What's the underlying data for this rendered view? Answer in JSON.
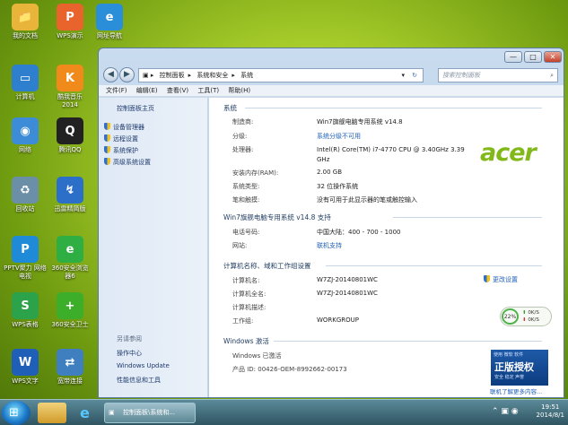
{
  "desktop": {
    "icons": [
      {
        "label": "我的文档",
        "name": "my-documents-icon",
        "color": "#e8b43a",
        "glyph": "📁"
      },
      {
        "label": "WPS演示",
        "name": "wps-presentation-icon",
        "color": "#e8642c",
        "glyph": "P"
      },
      {
        "label": "网址导航",
        "name": "ie-browser-icon",
        "color": "#2a8fd8",
        "glyph": "e"
      },
      {
        "label": "计算机",
        "name": "computer-icon",
        "color": "#2f7fcf",
        "glyph": "▭"
      },
      {
        "label": "酷我音乐\n2014",
        "name": "kuwo-music-icon",
        "color": "#f08a1a",
        "glyph": "K"
      },
      {
        "label": "网络",
        "name": "network-icon",
        "color": "#3c8cd8",
        "glyph": "◉"
      },
      {
        "label": "腾讯QQ",
        "name": "qq-icon",
        "color": "#222222",
        "glyph": "Q"
      },
      {
        "label": "回收站",
        "name": "recycle-bin-icon",
        "color": "#6b8fa6",
        "glyph": "♻"
      },
      {
        "label": "迅雷精简版",
        "name": "xunlei-icon",
        "color": "#2b6fc9",
        "glyph": "↯"
      },
      {
        "label": "PPTV聚力 网络电视",
        "name": "pptv-icon",
        "color": "#1f8ad8",
        "glyph": "P"
      },
      {
        "label": "360安全浏览器6",
        "name": "360-browser-icon",
        "color": "#2fae43",
        "glyph": "e"
      },
      {
        "label": "WPS表格",
        "name": "wps-spreadsheet-icon",
        "color": "#2ca24a",
        "glyph": "S"
      },
      {
        "label": "360安全卫士",
        "name": "360-security-icon",
        "color": "#3cae2a",
        "glyph": "+"
      },
      {
        "label": "WPS文字",
        "name": "wps-writer-icon",
        "color": "#1f5fb8",
        "glyph": "W"
      },
      {
        "label": "宽带连接",
        "name": "broadband-icon",
        "color": "#3f7fbf",
        "glyph": "⇄"
      }
    ]
  },
  "window": {
    "controls": {
      "minimize": "—",
      "maximize": "□",
      "close": "✕"
    },
    "nav": {
      "back": "◀",
      "forward": "▶"
    },
    "breadcrumb": [
      "控制面板",
      "系统和安全",
      "系统"
    ],
    "search_placeholder": "搜索控制面板",
    "menu": [
      "文件(F)",
      "编辑(E)",
      "查看(V)",
      "工具(T)",
      "帮助(H)"
    ]
  },
  "sidebar": {
    "home": "控制面板主页",
    "items": [
      "设备管理器",
      "远程设置",
      "系统保护",
      "高级系统设置"
    ],
    "see_also": "另请参阅",
    "links": [
      "操作中心",
      "Windows Update",
      "性能信息和工具"
    ]
  },
  "system": {
    "section_title": "系统",
    "rows": [
      {
        "label": "制造商:",
        "value": "Win7旗舰电脑专用系统 v14.8"
      },
      {
        "label": "分级:",
        "value": "系统分级不可用"
      },
      {
        "label": "处理器:",
        "value": "Intel(R) Core(TM) i7-4770 CPU @ 3.40GHz   3.39 GHz"
      },
      {
        "label": "安装内存(RAM):",
        "value": "2.00 GB"
      },
      {
        "label": "系统类型:",
        "value": "32 位操作系统"
      },
      {
        "label": "笔和触摸:",
        "value": "没有可用于此显示器的笔或触控输入"
      }
    ],
    "brand_logo": "acer"
  },
  "support": {
    "section_title": "Win7旗舰电脑专用系统 v14.8 支持",
    "rows": [
      {
        "label": "电话号码:",
        "value": "中国大陆：400 - 700 - 1000"
      },
      {
        "label": "网站:",
        "value": "联机支持"
      }
    ]
  },
  "computer": {
    "section_title": "计算机名称、域和工作组设置",
    "rows": [
      {
        "label": "计算机名:",
        "value": "W7ZJ-20140801WC"
      },
      {
        "label": "计算机全名:",
        "value": "W7ZJ-20140801WC"
      },
      {
        "label": "计算机描述:",
        "value": ""
      },
      {
        "label": "工作组:",
        "value": "WORKGROUP"
      }
    ],
    "change_settings": "更改设置"
  },
  "network_gauge": {
    "percent": "22%",
    "up": "0K/S",
    "down": "0K/S"
  },
  "activation": {
    "section_title": "Windows 激活",
    "status": "Windows 已激活",
    "product_id": "产品 ID: 00426-OEM-8992662-00173",
    "genuine_badge": {
      "line1": "使用 微软 软件",
      "line2": "正版授权",
      "line3": "安全 稳定 声誉"
    },
    "more_info": "联机了解更多内容..."
  },
  "taskbar": {
    "task_label": "控制面板\\系统和...",
    "time": "19:51",
    "date": "2014/8/1"
  }
}
